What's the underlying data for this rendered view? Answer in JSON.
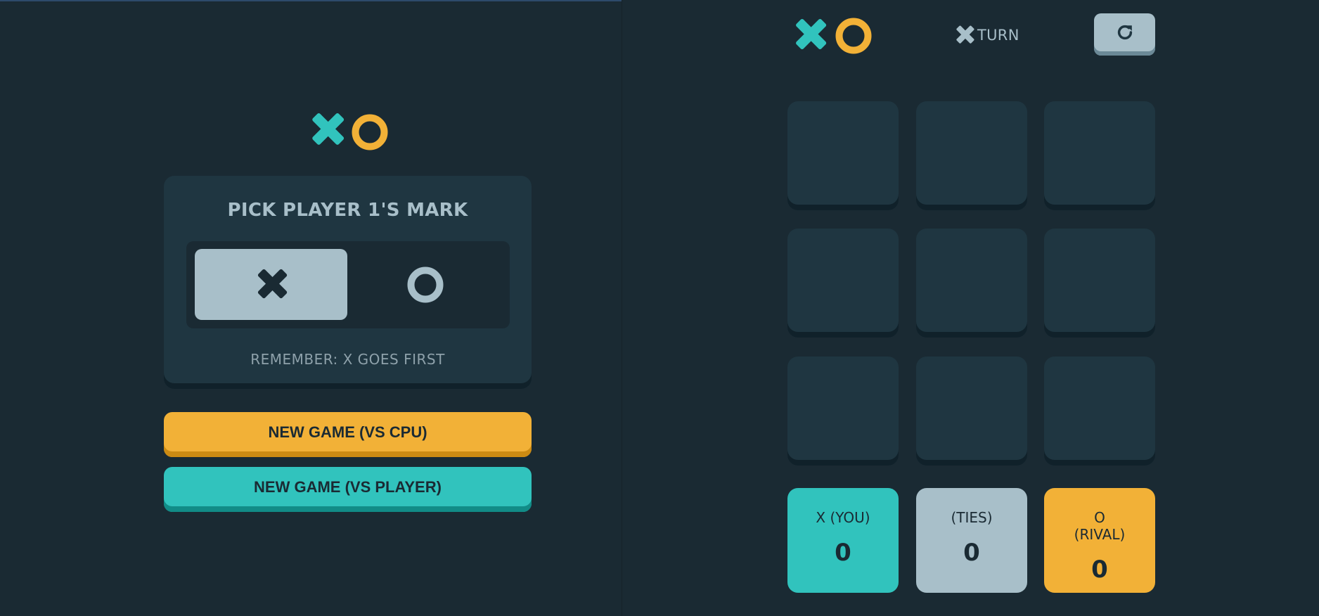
{
  "colors": {
    "background": "#1a2a33",
    "card": "#1f3641",
    "silver": "#a8bfc9",
    "teal": "#31c3bd",
    "yellow": "#f2b137"
  },
  "menu": {
    "logo_icons": [
      "x-mark-icon",
      "o-mark-icon"
    ],
    "pick_title": "PICK PLAYER 1'S MARK",
    "options": [
      {
        "mark": "X",
        "icon": "x-mark-icon",
        "selected": true
      },
      {
        "mark": "O",
        "icon": "o-mark-icon",
        "selected": false
      }
    ],
    "reminder": "REMEMBER: X GOES FIRST",
    "new_game_cpu": "NEW GAME (VS CPU)",
    "new_game_player": "NEW GAME (VS PLAYER)"
  },
  "game": {
    "turn_mark_icon": "x-mark-icon",
    "turn_label": "TURN",
    "restart_icon": "restart-icon",
    "board": [
      "",
      "",
      "",
      "",
      "",
      "",
      "",
      "",
      ""
    ],
    "scores": {
      "x": {
        "label": "X (YOU)",
        "value": "0"
      },
      "ties": {
        "label": "(TIES)",
        "value": "0"
      },
      "o": {
        "label": "O (RIVAL)",
        "value": "0"
      }
    }
  }
}
